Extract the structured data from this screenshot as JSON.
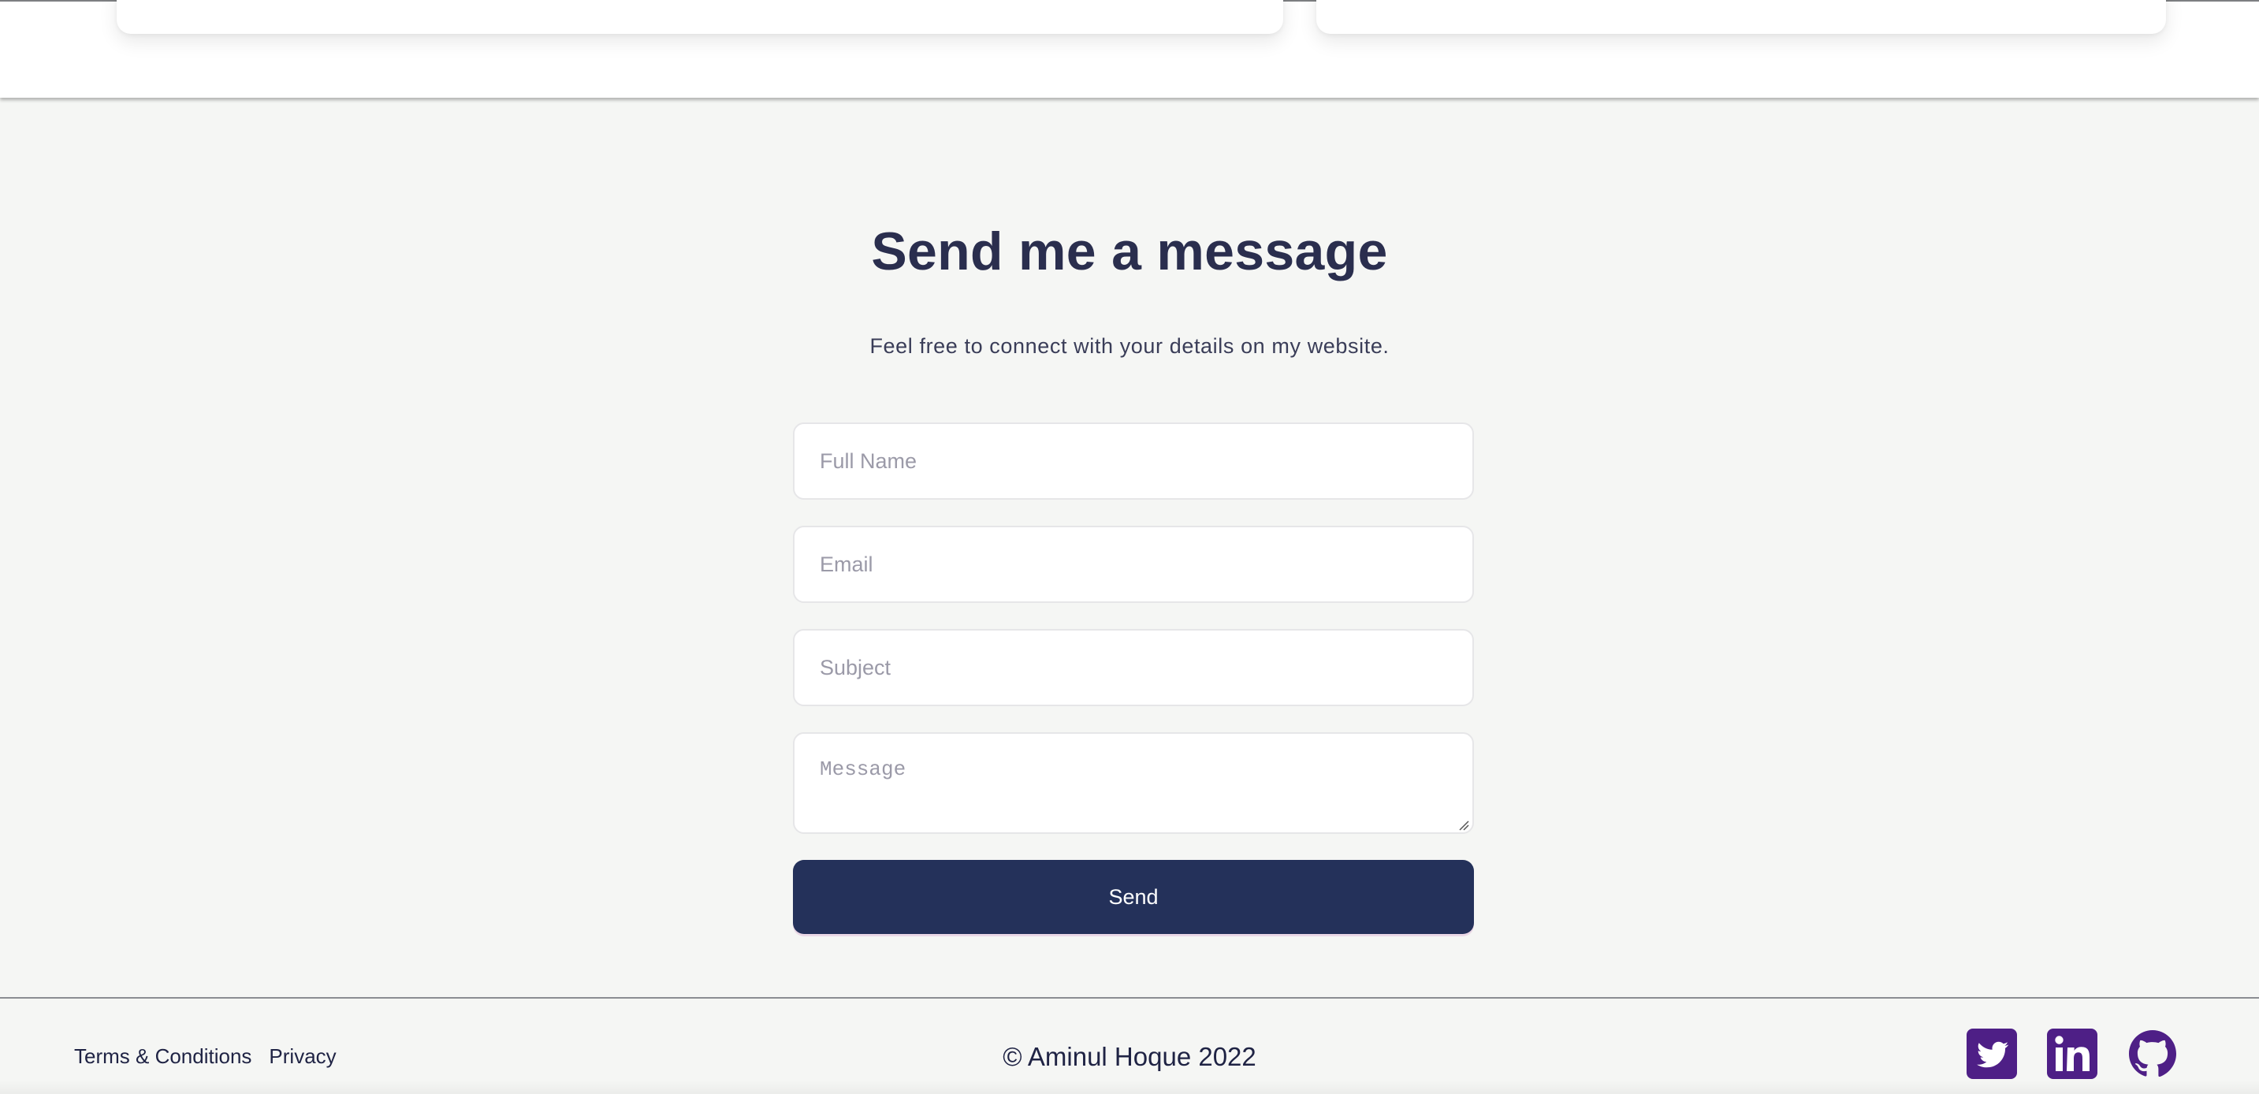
{
  "contact": {
    "heading": "Send me a message",
    "subtext": "Feel free to connect with your details on my website.",
    "fields": {
      "name_placeholder": "Full Name",
      "email_placeholder": "Email",
      "subject_placeholder": "Subject",
      "message_placeholder": "Message"
    },
    "send_label": "Send"
  },
  "footer": {
    "links": [
      "Terms & Conditions",
      "Privacy"
    ],
    "copyright": "© Aminul Hoque 2022",
    "socials": [
      {
        "icon": "twitter-icon"
      },
      {
        "icon": "linkedin-icon"
      },
      {
        "icon": "github-icon"
      }
    ],
    "icon_color": "#4e1f86"
  },
  "colors": {
    "page_bg": "#f5f6f4",
    "heading": "#2a2e4e",
    "button_bg": "#24315a",
    "button_text": "#ffffff"
  }
}
